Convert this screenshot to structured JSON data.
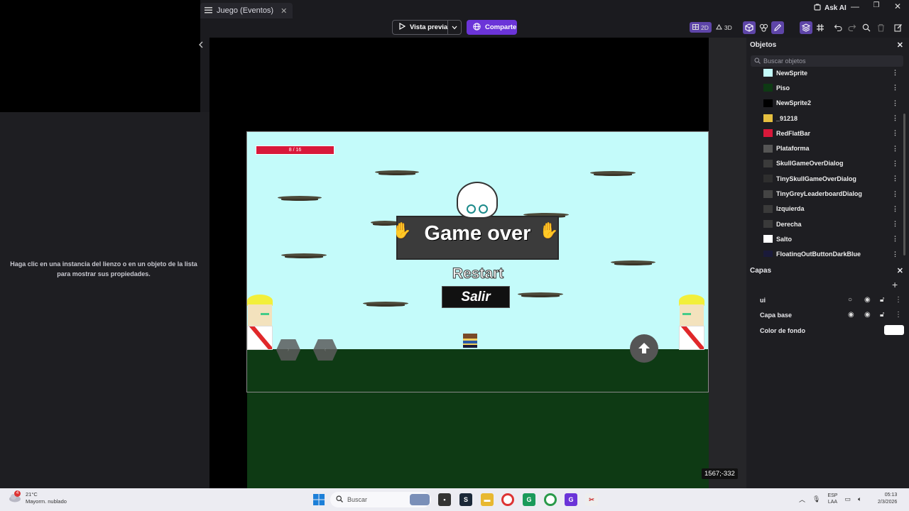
{
  "titlebar": {
    "tab_label": "Juego (Eventos)",
    "tab_close": "✕",
    "ask_ai": "Ask AI",
    "minimize": "—",
    "restore": "❐",
    "close": "✕"
  },
  "toolbar": {
    "preview_label": "Vista previa",
    "share_label": "Comparte",
    "view_2d": "2D",
    "view_3d": "3D"
  },
  "left_panel": {
    "hint": "Haga clic en una instancia del lienzo o en un objeto de la lista para mostrar sus propiedades."
  },
  "game": {
    "health_text": "8 / 16",
    "game_over": "Game over",
    "restart": "Restart",
    "exit": "Salir",
    "coords": "1567;-332"
  },
  "objects_panel": {
    "title": "Objetos",
    "search_placeholder": "Buscar objetos",
    "items": [
      {
        "label": "NewSprite",
        "color": "#c4fbfa"
      },
      {
        "label": "Piso",
        "color": "#0e3a14"
      },
      {
        "label": "NewSprite2",
        "color": "#000000"
      },
      {
        "label": "_91218",
        "color": "#e6c040"
      },
      {
        "label": "RedFlatBar",
        "color": "#d8183a"
      },
      {
        "label": "Plataforma",
        "color": "#555555"
      },
      {
        "label": "SkullGameOverDialog",
        "color": "#3b3b3b"
      },
      {
        "label": "TinySkullGameOverDialog",
        "color": "#2e2e2e"
      },
      {
        "label": "TinyGreyLeaderboardDialog",
        "color": "#444444"
      },
      {
        "label": "Izquierda",
        "color": "#3a3a3a"
      },
      {
        "label": "Derecha",
        "color": "#3a3a3a"
      },
      {
        "label": "Salto",
        "color": "#ffffff"
      },
      {
        "label": "FloatingOutButtonDarkBlue",
        "color": "#1a1a3a"
      }
    ]
  },
  "layers_panel": {
    "title": "Capas",
    "add": "+",
    "layers": [
      {
        "label": "ui"
      },
      {
        "label": "Capa base"
      }
    ],
    "background_color_label": "Color de fondo",
    "background_color": "#ffffff"
  },
  "taskbar": {
    "weather_temp": "21°C",
    "weather_desc": "Mayorm. nublado",
    "weather_badge": "4",
    "search_label": "Buscar",
    "lang_1": "ESP",
    "lang_2": "LAA",
    "time": "05:13",
    "date": "2/3/2026"
  }
}
